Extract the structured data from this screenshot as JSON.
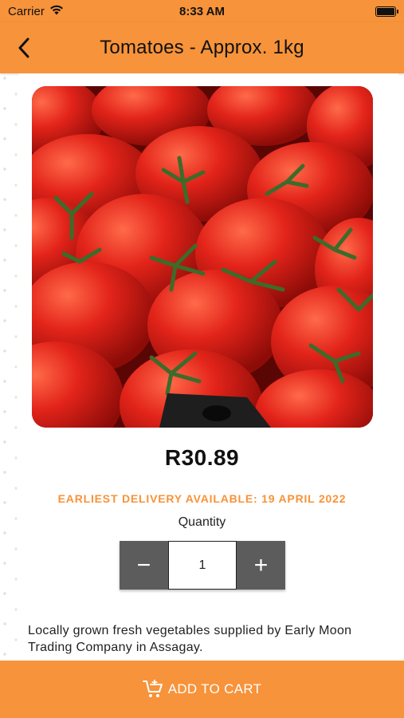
{
  "status_bar": {
    "carrier": "Carrier",
    "time": "8:33 AM",
    "wifi_icon": "wifi-icon",
    "battery_icon": "battery-icon"
  },
  "header": {
    "title": "Tomatoes - Approx. 1kg",
    "back_icon": "chevron-left-icon",
    "background_color": "#f7933a"
  },
  "product": {
    "image_subject": "tomatoes",
    "price": "R30.89",
    "delivery_note": "EARLIEST DELIVERY AVAILABLE: 19 APRIL 2022",
    "quantity_label": "Quantity",
    "quantity_value": "1",
    "decrement_label": "−",
    "increment_label": "+",
    "description": "Locally grown fresh vegetables supplied by Early Moon Trading Company in Assagay."
  },
  "cart": {
    "button_label": "ADD TO CART",
    "cart_icon": "cart-add-icon"
  },
  "colors": {
    "accent": "#f7933a",
    "stepper_button": "#5c5c5c",
    "text": "#111111"
  }
}
